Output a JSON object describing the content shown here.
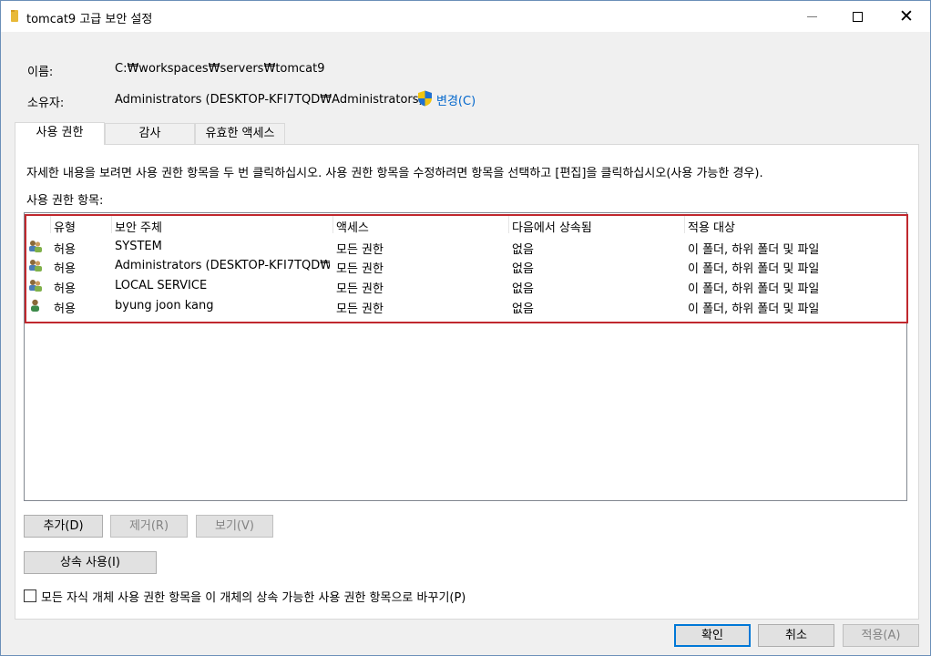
{
  "window": {
    "title": "tomcat9 고급 보안 설정"
  },
  "info": {
    "name_label": "이름:",
    "name_value": "C:₩workspaces₩servers₩tomcat9",
    "owner_label": "소유자:",
    "owner_value": "Administrators (DESKTOP-KFI7TQD₩Administrators)",
    "change_link": "변경(C)"
  },
  "tabs": [
    "사용 권한",
    "감사",
    "유효한 액세스"
  ],
  "panel": {
    "instruction": "자세한 내용을 보려면 사용 권한 항목을 두 번 클릭하십시오. 사용 권한 항목을 수정하려면 항목을 선택하고 [편집]을 클릭하십시오(사용 가능한 경우).",
    "entries_label": "사용 권한 항목:"
  },
  "table": {
    "columns": [
      "유형",
      "보안 주체",
      "액세스",
      "다음에서 상속됨",
      "적용 대상"
    ],
    "rows": [
      {
        "icon": "group-users-icon",
        "type": "허용",
        "principal": "SYSTEM",
        "access": "모든 권한",
        "inherited": "없음",
        "applies": "이 폴더, 하위 폴더 및 파일"
      },
      {
        "icon": "group-users-icon",
        "type": "허용",
        "principal": "Administrators (DESKTOP-KFI7TQD₩...",
        "access": "모든 권한",
        "inherited": "없음",
        "applies": "이 폴더, 하위 폴더 및 파일"
      },
      {
        "icon": "group-users-icon",
        "type": "허용",
        "principal": "LOCAL SERVICE",
        "access": "모든 권한",
        "inherited": "없음",
        "applies": "이 폴더, 하위 폴더 및 파일"
      },
      {
        "icon": "single-user-icon",
        "type": "허용",
        "principal": "byung joon kang",
        "access": "모든 권한",
        "inherited": "없음",
        "applies": "이 폴더, 하위 폴더 및 파일"
      }
    ]
  },
  "buttons": {
    "add": "추가(D)",
    "remove": "제거(R)",
    "view": "보기(V)",
    "enable_inheritance": "상속 사용(I)",
    "ok": "확인",
    "cancel": "취소",
    "apply": "적용(A)"
  },
  "checkbox": {
    "label": "모든 자식 개체 사용 권한 항목을 이 개체의 상속 가능한 사용 권한 항목으로 바꾸기(P)",
    "checked": false
  },
  "colors": {
    "highlight_border": "#c0282e",
    "link": "#0066cc",
    "default_button_border": "#0078d7"
  }
}
